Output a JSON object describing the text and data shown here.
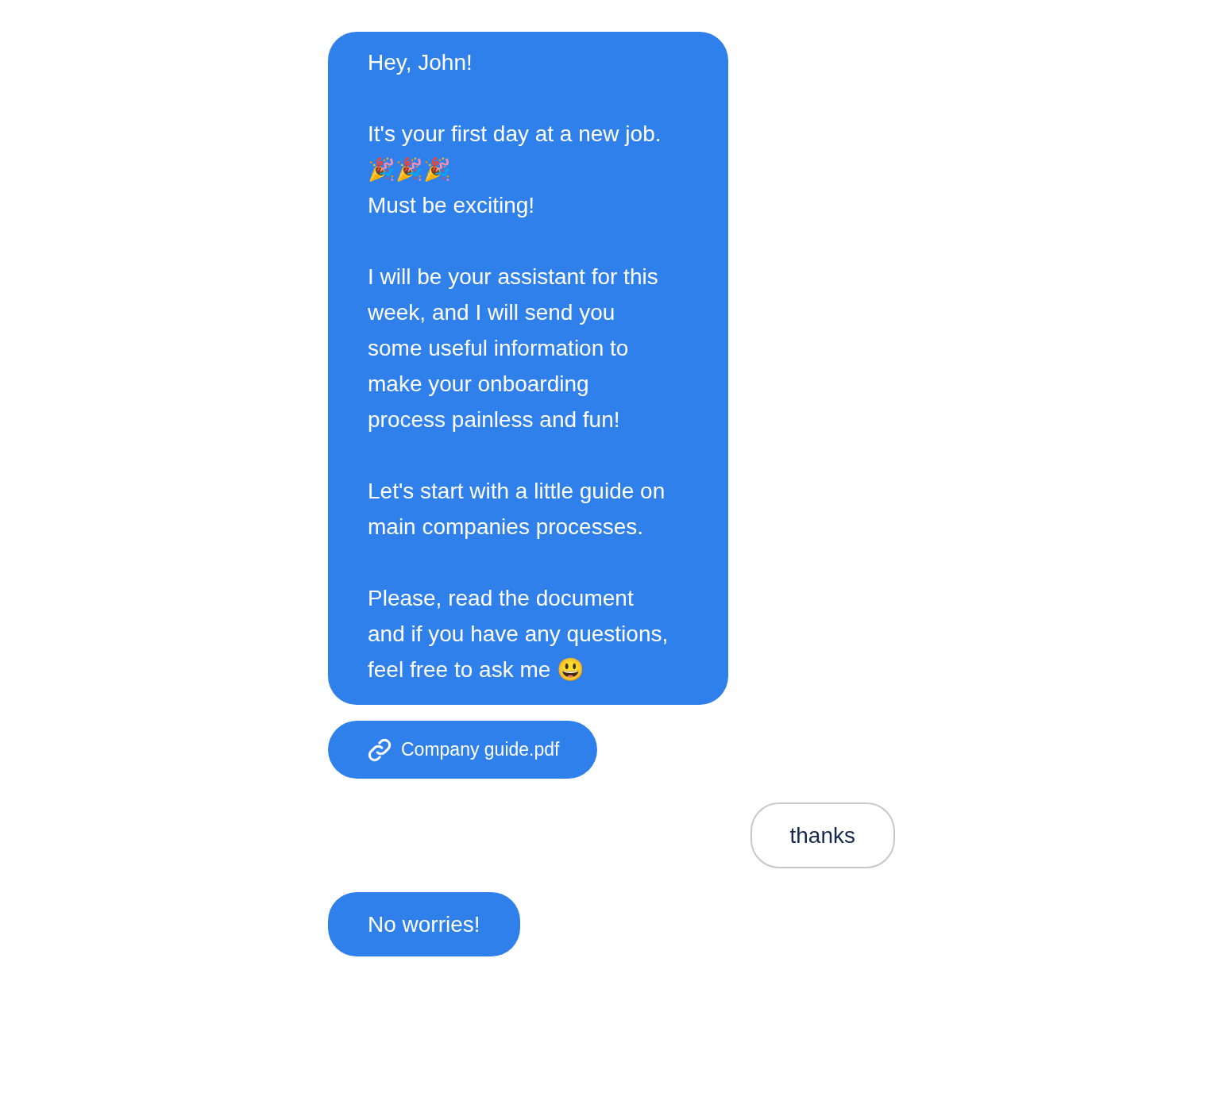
{
  "messages": [
    {
      "outgoing": false,
      "kind": "text",
      "text": "Hey, John!\n\nIt's your first day at a new job. 🎉🎉🎉\nMust be exciting!\n\nI will be your assistant for this week, and I will send you some useful information to make your onboarding process painless and fun!\n\nLet's start with a little guide on main companies processes.\n\nPlease, read the document and if you have any questions, feel free to ask me 😃"
    },
    {
      "outgoing": false,
      "kind": "attachment",
      "text": "Company guide.pdf"
    },
    {
      "outgoing": true,
      "kind": "text",
      "text": "thanks"
    },
    {
      "outgoing": false,
      "kind": "text",
      "text": "No worries!"
    }
  ]
}
